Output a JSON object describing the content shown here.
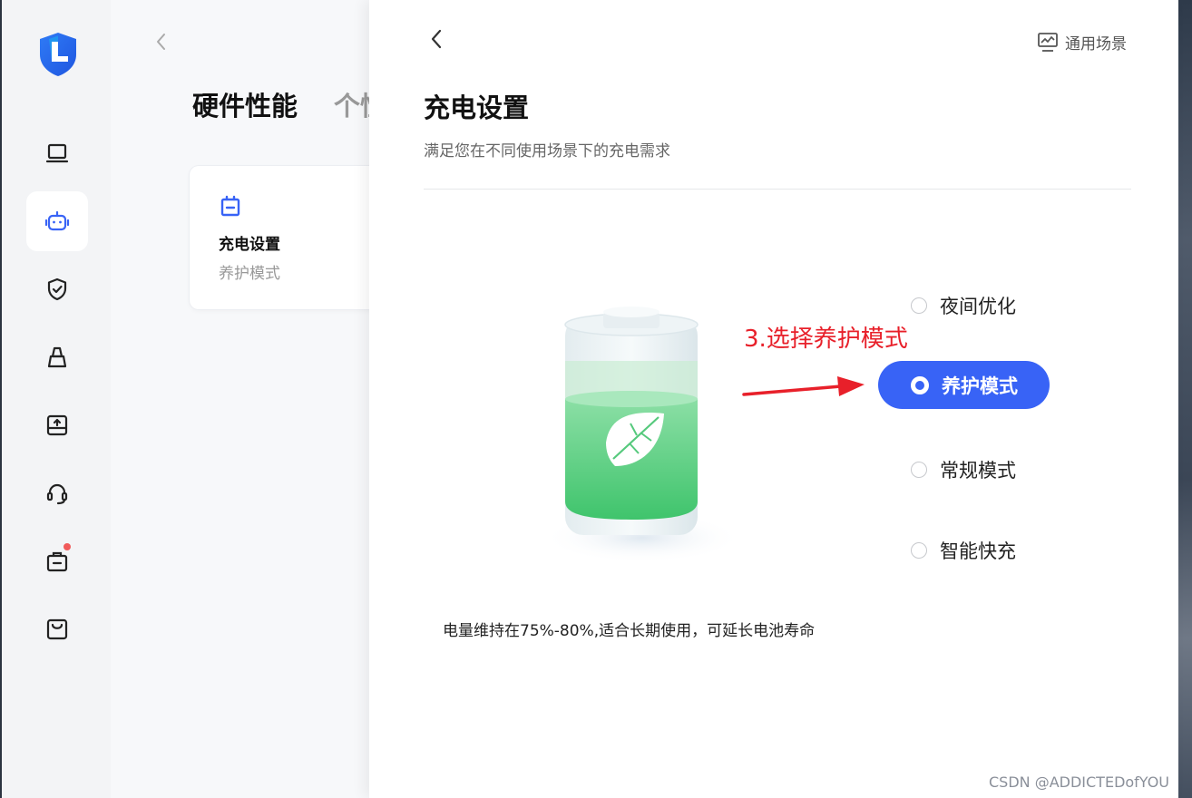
{
  "sidebar": {
    "logo_icon": "app-logo-shield-L",
    "items": [
      {
        "icon": "laptop-icon",
        "active": false
      },
      {
        "icon": "robot-icon",
        "active": true
      },
      {
        "icon": "shield-check-icon",
        "active": false
      },
      {
        "icon": "broom-icon",
        "active": false
      },
      {
        "icon": "upload-box-icon",
        "active": false
      },
      {
        "icon": "headset-icon",
        "active": false
      },
      {
        "icon": "toolbox-icon",
        "active": false,
        "badge": true
      },
      {
        "icon": "shopping-bag-icon",
        "active": false
      }
    ]
  },
  "background_page": {
    "title": "硬件性能",
    "tab2": "个性",
    "card": {
      "title": "充电设置",
      "subtitle": "养护模式",
      "icon": "battery-icon"
    }
  },
  "panel": {
    "scene_button": "通用场景",
    "title": "充电设置",
    "subtitle": "满足您在不同使用场景下的充电需求",
    "options": [
      {
        "label": "夜间优化",
        "selected": false
      },
      {
        "label": "养护模式",
        "selected": true
      },
      {
        "label": "常规模式",
        "selected": false
      },
      {
        "label": "智能快充",
        "selected": false
      }
    ],
    "description": "电量维持在75%-80%,适合长期使用，可延长电池寿命"
  },
  "annotation": "3.选择养护模式",
  "watermark": "CSDN @ADDICTEDofYOU",
  "colors": {
    "accent": "#3863f6",
    "annotation": "#e8202a",
    "battery_green": "#4ccb78"
  }
}
